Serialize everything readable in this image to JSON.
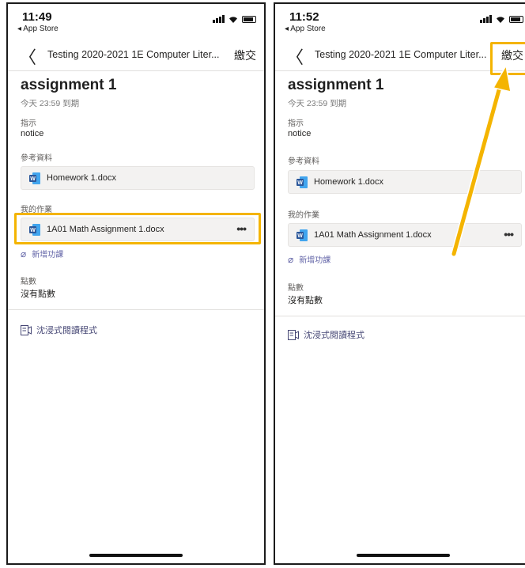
{
  "left": {
    "status": {
      "time": "11:49",
      "back_app": "◂ App Store"
    },
    "nav": {
      "title": "Testing 2020-2021 1E Computer Liter...",
      "submit": "繳交"
    },
    "assignment": {
      "title": "assignment 1",
      "due": "今天 23:59 到期"
    },
    "instructions": {
      "label": "指示",
      "value": "notice"
    },
    "reference": {
      "label": "參考資料",
      "file": "Homework 1.docx"
    },
    "my_work": {
      "label": "我的作業",
      "file": "1A01 Math Assignment 1.docx",
      "more": "•••",
      "add": "新增功課"
    },
    "points": {
      "label": "點數",
      "value": "沒有點數"
    },
    "reader": "沈浸式閱讀程式"
  },
  "right": {
    "status": {
      "time": "11:52",
      "back_app": "◂ App Store"
    },
    "nav": {
      "title": "Testing 2020-2021 1E Computer Liter...",
      "submit": "繳交"
    },
    "assignment": {
      "title": "assignment 1",
      "due": "今天 23:59 到期"
    },
    "instructions": {
      "label": "指示",
      "value": "notice"
    },
    "reference": {
      "label": "參考資料",
      "file": "Homework 1.docx"
    },
    "my_work": {
      "label": "我的作業",
      "file": "1A01 Math Assignment 1.docx",
      "more": "•••",
      "add": "新增功課"
    },
    "points": {
      "label": "點數",
      "value": "沒有點數"
    },
    "reader": "沈浸式閱讀程式"
  },
  "colors": {
    "highlight": "#f4b400",
    "accent": "#6264a7",
    "word_blue": "#2b579a"
  },
  "icons": [
    "signal-icon",
    "wifi-icon",
    "battery-icon",
    "back-chevron-icon",
    "word-doc-icon",
    "paperclip-icon",
    "immersive-reader-icon",
    "more-icon"
  ]
}
